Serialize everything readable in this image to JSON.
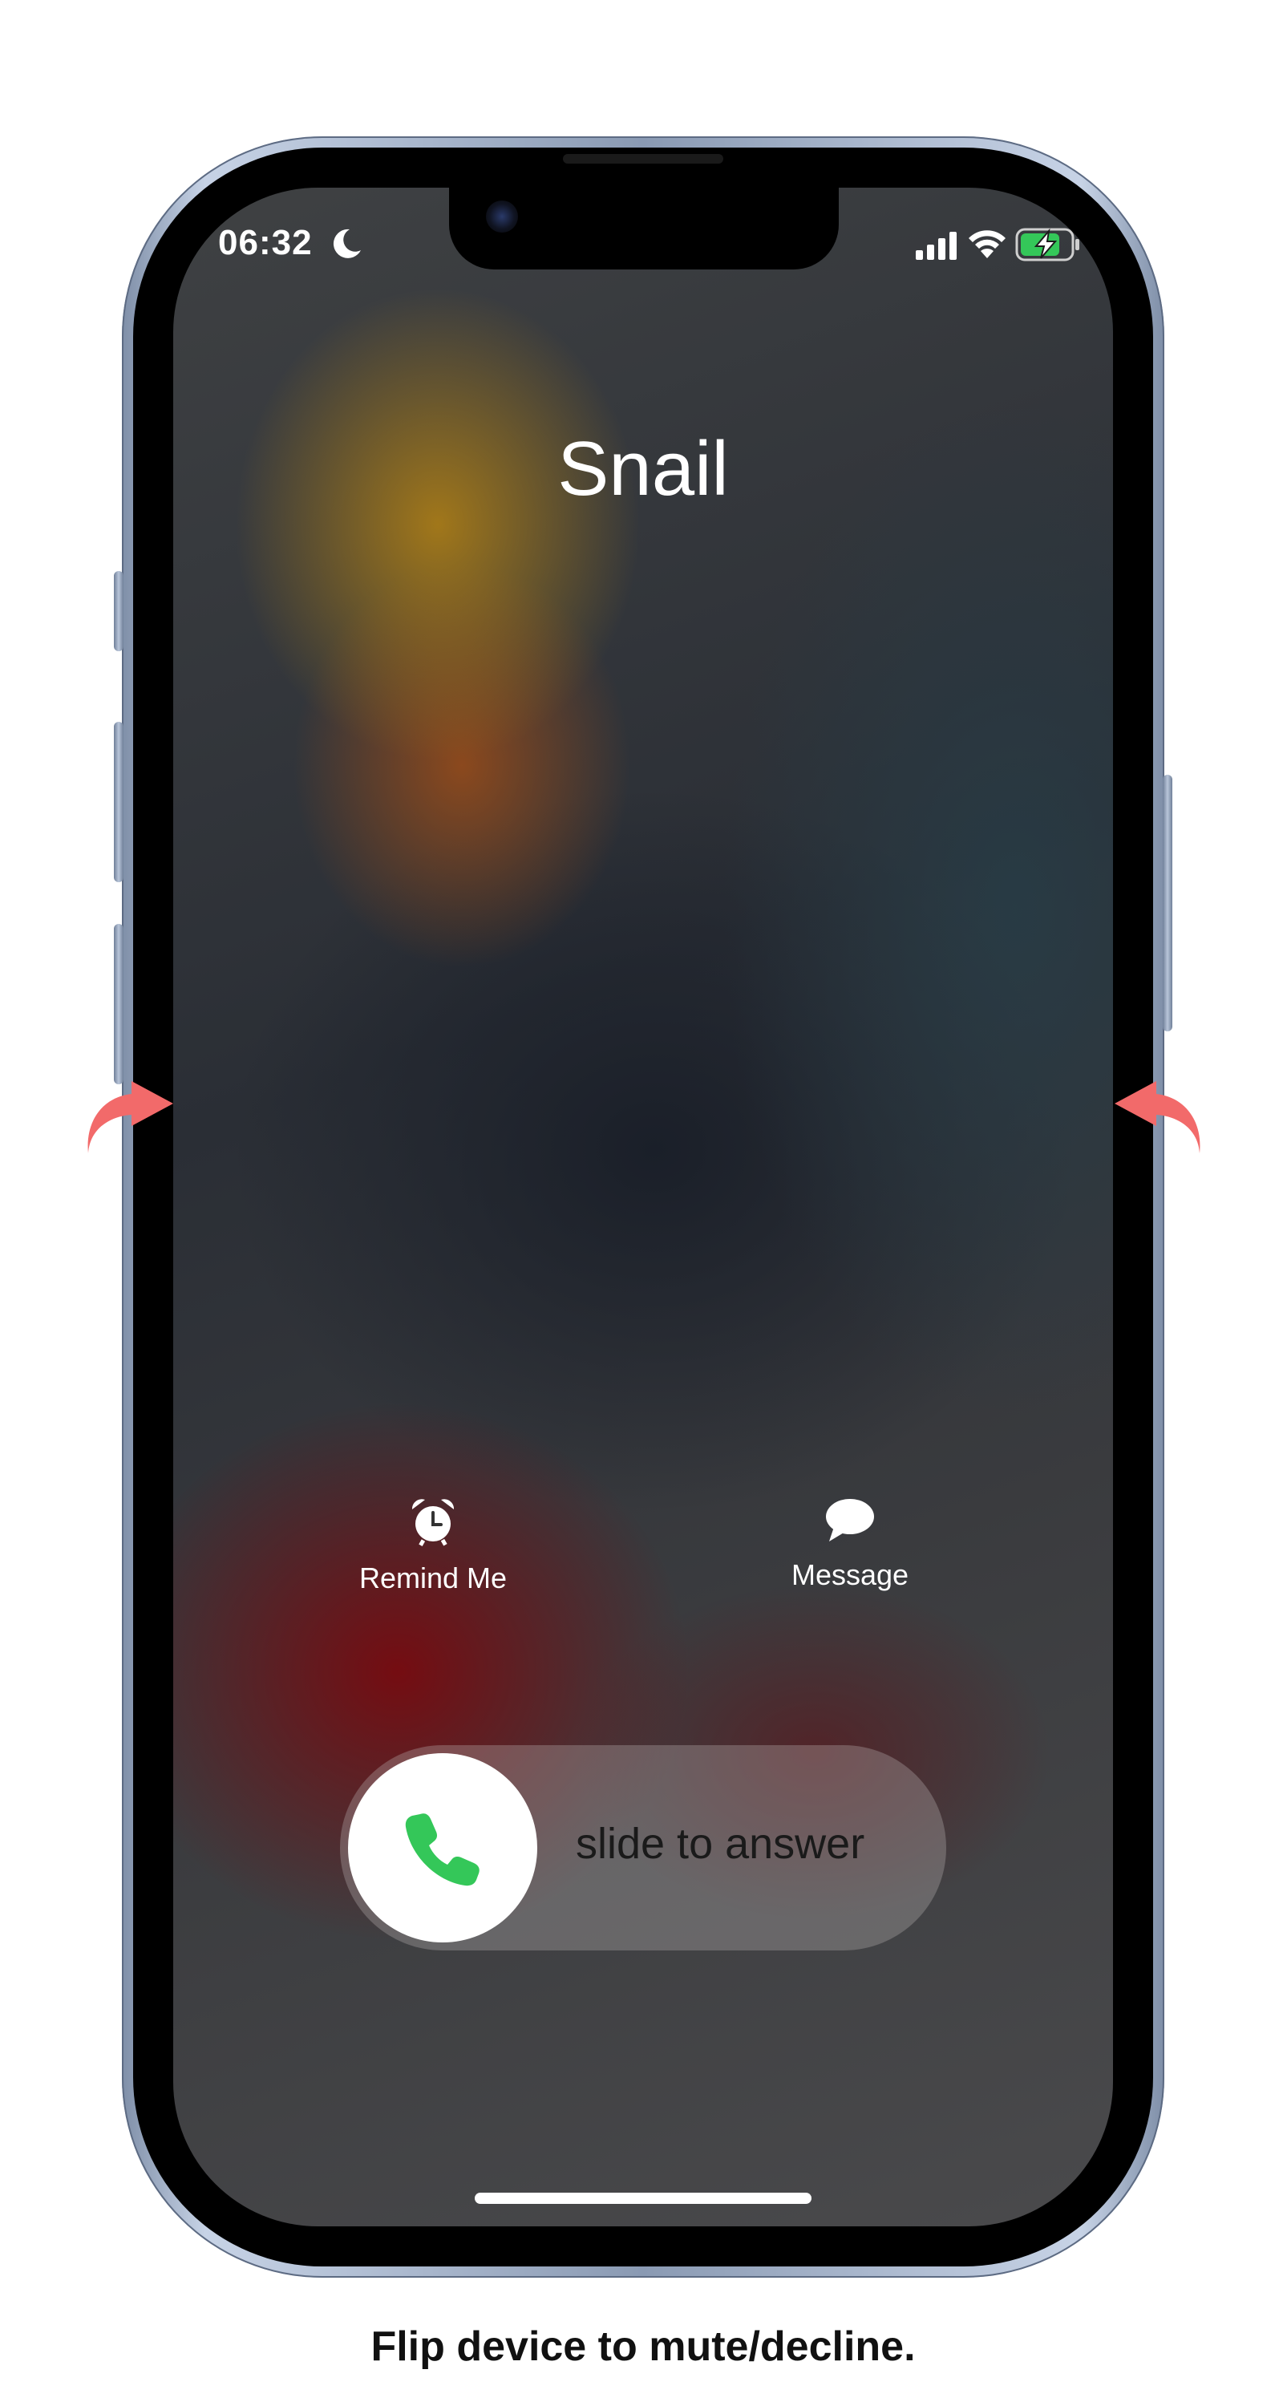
{
  "status_bar": {
    "time": "06:32",
    "icons": [
      "moon-icon",
      "cellular-signal-icon",
      "wifi-icon",
      "battery-charging-icon"
    ]
  },
  "call": {
    "caller_name": "Snail",
    "actions": [
      {
        "label": "Remind Me",
        "icon": "alarm-clock-icon"
      },
      {
        "label": "Message",
        "icon": "message-bubble-icon"
      }
    ],
    "slider_text": "slide to answer",
    "slider_icon": "phone-icon"
  },
  "caption": "Flip device to mute/decline.",
  "colors": {
    "accent_green": "#34C759",
    "arrow_red": "#F26A6A",
    "battery_green": "#34C759"
  }
}
